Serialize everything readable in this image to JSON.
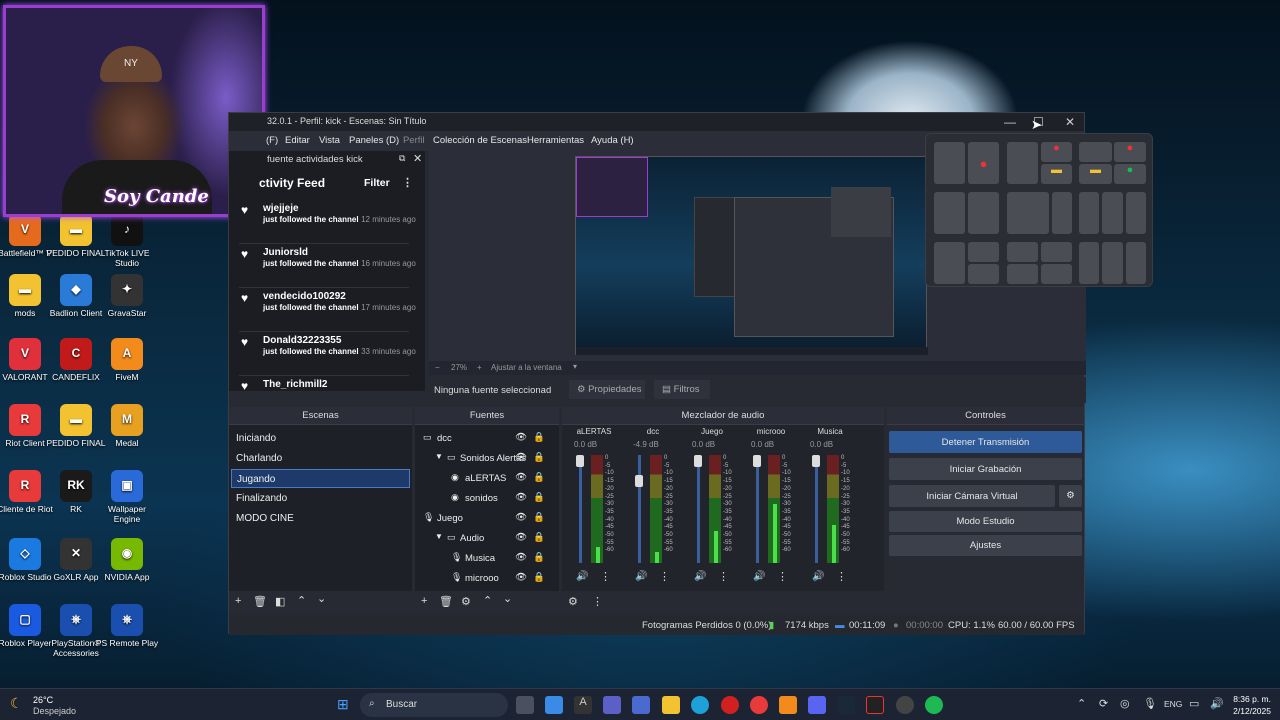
{
  "desktop_icons": [
    {
      "label": "Battlefield™ V",
      "color": "#e56a1e",
      "glyph": "V"
    },
    {
      "label": "PEDIDO FINAL",
      "color": "#f2c230",
      "glyph": "▬"
    },
    {
      "label": "TikTok LIVE Studio",
      "color": "#111",
      "glyph": "♪"
    },
    {
      "label": "mods",
      "color": "#f2c230",
      "glyph": "▬"
    },
    {
      "label": "Badlion Client",
      "color": "#2a7ad8",
      "glyph": "◆"
    },
    {
      "label": "GravaStar",
      "color": "#333",
      "glyph": "✦"
    },
    {
      "label": "VALORANT",
      "color": "#e0303c",
      "glyph": "V"
    },
    {
      "label": "CANDEFLIX",
      "color": "#c01a1a",
      "glyph": "C"
    },
    {
      "label": "FiveM",
      "color": "#f28a1c",
      "glyph": "A"
    },
    {
      "label": "Riot Client",
      "color": "#e83a3a",
      "glyph": "R"
    },
    {
      "label": "PEDIDO FINAL",
      "color": "#f2c230",
      "glyph": "▬"
    },
    {
      "label": "Medal",
      "color": "#e8a020",
      "glyph": "M"
    },
    {
      "label": "Cliente de Riot",
      "color": "#e83a3a",
      "glyph": "R"
    },
    {
      "label": "RK",
      "color": "#1a1a1a",
      "glyph": "RK"
    },
    {
      "label": "Wallpaper Engine",
      "color": "#2a6ad8",
      "glyph": "▣"
    },
    {
      "label": "Roblox Studio",
      "color": "#1a7ae0",
      "glyph": "◇"
    },
    {
      "label": "GoXLR App",
      "color": "#333",
      "glyph": "✕"
    },
    {
      "label": "NVIDIA App",
      "color": "#76b900",
      "glyph": "◉"
    },
    {
      "label": "Roblox Player",
      "color": "#1a5ae0",
      "glyph": "▢"
    },
    {
      "label": "PlayStation® Accessories",
      "color": "#1a4fb0",
      "glyph": "⎈"
    },
    {
      "label": "PS Remote Play",
      "color": "#1a4fb0",
      "glyph": "⎈"
    }
  ],
  "webcam": {
    "cap_text": "NY",
    "overlay_text": "Soy Cande"
  },
  "window": {
    "title": "32.0.1 - Perfil: kick - Escenas: Sin Título",
    "min": "—",
    "max": "☐",
    "close": "✕"
  },
  "menu": [
    "(F)",
    "Editar",
    "Vista",
    "Paneles (D)",
    "Perfil",
    "Colección de Escenas",
    "Herramientas",
    "Ayuda (H)"
  ],
  "activity": {
    "dock_title": "fuente actividades kick",
    "header": "ctivity Feed",
    "filter": "Filter",
    "items": [
      {
        "name": "wjejjeje",
        "text": "just followed the channel",
        "time": "12 minutes ago"
      },
      {
        "name": "Juniorsld",
        "text": "just followed the channel",
        "time": "16 minutes ago"
      },
      {
        "name": "vendecido100292",
        "text": "just followed the channel",
        "time": "17 minutes ago"
      },
      {
        "name": "Donald32223355",
        "text": "just followed the channel",
        "time": "33 minutes ago"
      },
      {
        "name": "The_richmill2",
        "text": "",
        "time": ""
      }
    ]
  },
  "preview": {
    "zoom": "27%",
    "fit": "Ajustar a la ventana",
    "no_source": "Ninguna fuente seleccionad",
    "props": "Propiedades",
    "filters": "Filtros"
  },
  "scenes": {
    "title": "Escenas",
    "items": [
      "Iniciando",
      "Charlando",
      "Jugando",
      "Finalizando",
      "MODO CINE"
    ],
    "selected": 2
  },
  "sources": {
    "title": "Fuentes",
    "items": [
      {
        "name": "dcc",
        "indent": 0,
        "icon": "▭"
      },
      {
        "name": "Sonidos Alertas",
        "indent": 1,
        "icon": "▭"
      },
      {
        "name": "aLERTAS",
        "indent": 2,
        "icon": "◉"
      },
      {
        "name": "sonidos",
        "indent": 2,
        "icon": "◉"
      },
      {
        "name": "Juego",
        "indent": 0,
        "icon": "🎙"
      },
      {
        "name": "Audio",
        "indent": 1,
        "icon": "▭"
      },
      {
        "name": "Musica",
        "indent": 2,
        "icon": "🎙"
      },
      {
        "name": "microoo",
        "indent": 2,
        "icon": "🎙"
      }
    ]
  },
  "mixer": {
    "title": "Mezclador de audio",
    "channels": [
      {
        "name": "aLERTAS",
        "db": "0.0 dB",
        "level": 0.15
      },
      {
        "name": "dcc",
        "db": "-4.9 dB",
        "level": 0.1
      },
      {
        "name": "Juego",
        "db": "0.0 dB",
        "level": 0.3
      },
      {
        "name": "microoo",
        "db": "0.0 dB",
        "level": 0.55
      },
      {
        "name": "Musica",
        "db": "0.0 dB",
        "level": 0.35
      }
    ],
    "scale": [
      "0",
      "-5",
      "-10",
      "-15",
      "-20",
      "-25",
      "-30",
      "-35",
      "-40",
      "-45",
      "-50",
      "-55",
      "-60"
    ]
  },
  "controls": {
    "title": "Controles",
    "stream": "Detener Transmisión",
    "record": "Iniciar Grabación",
    "vcam": "Iniciar Cámara Virtual",
    "studio": "Modo Estudio",
    "settings": "Ajustes"
  },
  "status": {
    "dropped": "Fotogramas Perdidos 0 (0.0%)",
    "kbps": "7174 kbps",
    "live": "00:11:09",
    "rec": "00:00:00",
    "cpu": "CPU: 1.1%",
    "fps": "60.00 / 60.00 FPS"
  },
  "taskbar": {
    "temp": "26°C",
    "weather": "Despejado",
    "search": "Buscar",
    "lang": "ENG",
    "time": "8:36 p. m.",
    "date": "2/12/2025"
  },
  "colors": {
    "accent": "#2f5a9a",
    "selected": "#1e3a6a",
    "live": "#2a6ad8"
  }
}
